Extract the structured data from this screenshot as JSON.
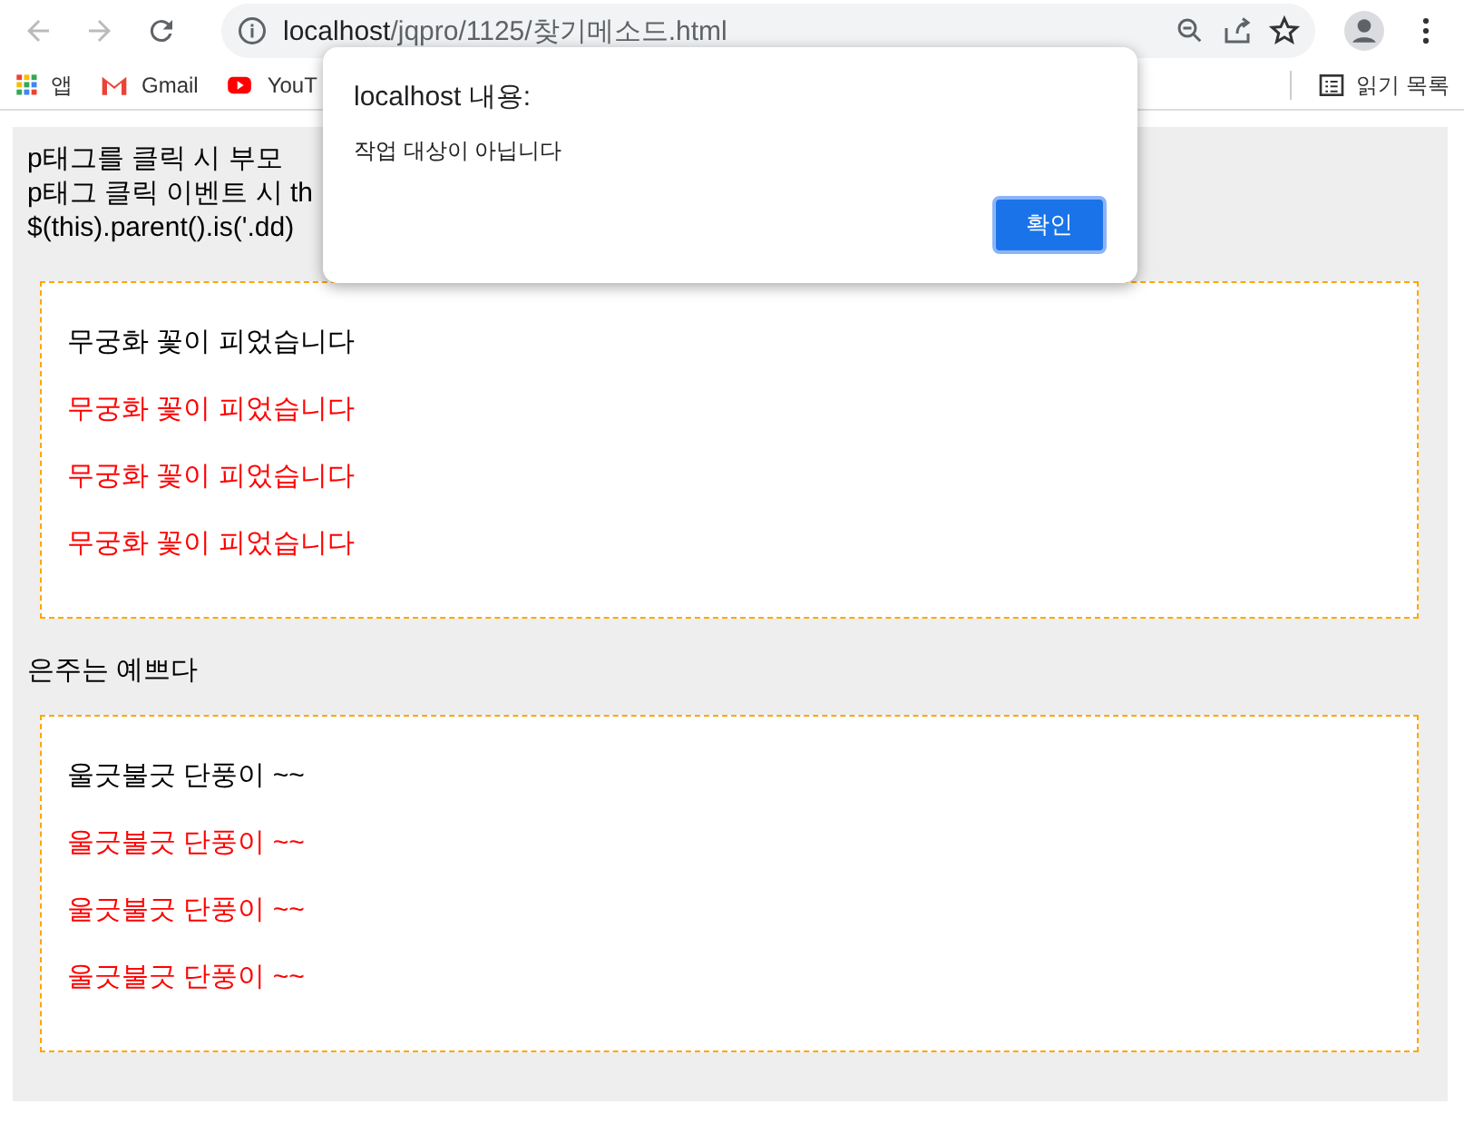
{
  "browser": {
    "url_host": "localhost",
    "url_path": "/jqpro/1125/찾기메소드.html"
  },
  "bookmarks": [
    {
      "label": "앱",
      "kind": "apps"
    },
    {
      "label": "Gmail",
      "kind": "gmail"
    },
    {
      "label": "YouT",
      "kind": "youtube"
    }
  ],
  "reading_list": "읽기 목록",
  "page": {
    "intro": [
      "p태그를 클릭 시 부모",
      "p태그 클릭 이벤트 시 th",
      "$(this).parent().is('.dd)"
    ],
    "group_1": [
      {
        "text": "무궁화 꽃이 피었습니다",
        "color": "#000000"
      },
      {
        "text": "무궁화 꽃이 피었습니다",
        "color": "#ff0000"
      },
      {
        "text": "무궁화 꽃이 피었습니다",
        "color": "#ff0000"
      },
      {
        "text": "무궁화 꽃이 피었습니다",
        "color": "#ff0000"
      }
    ],
    "middle_text": "은주는 예쁘다",
    "group_2": [
      {
        "text": "울긋불긋 단풍이 ~~",
        "color": "#000000"
      },
      {
        "text": "울긋불긋 단풍이 ~~",
        "color": "#ff0000"
      },
      {
        "text": "울긋불긋 단풍이 ~~",
        "color": "#ff0000"
      },
      {
        "text": "울긋불긋 단풍이 ~~",
        "color": "#ff0000"
      }
    ]
  },
  "dialog": {
    "title": "localhost 내용:",
    "message": "작업 대상이 아닙니다",
    "button": "확인"
  }
}
